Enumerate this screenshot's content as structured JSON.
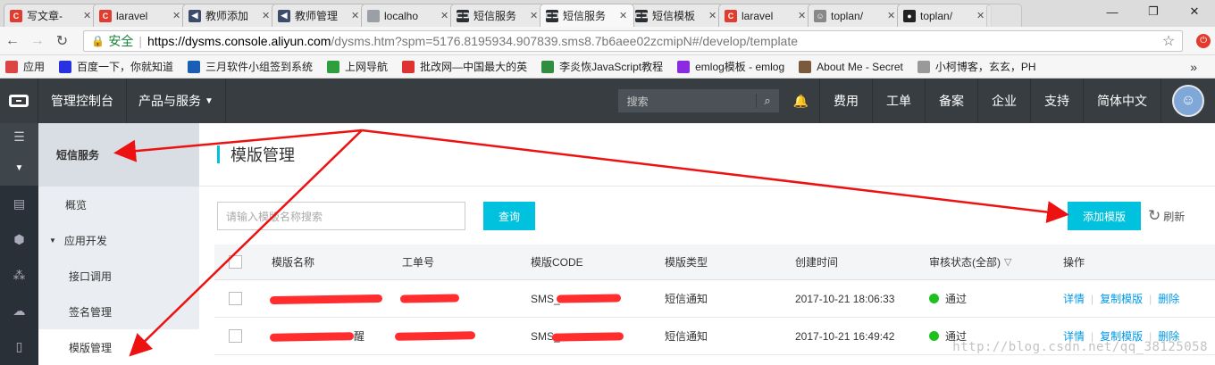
{
  "browser": {
    "tabs": [
      {
        "label": "写文章-",
        "icon": "csdn-icon",
        "color": "#e33b2e",
        "glyph": "C"
      },
      {
        "label": "laravel",
        "icon": "csdn-icon",
        "color": "#e33b2e",
        "glyph": "C"
      },
      {
        "label": "教师添加",
        "icon": "media-icon",
        "color": "#3b4d6b",
        "glyph": "◀"
      },
      {
        "label": "教师管理",
        "icon": "media-icon",
        "color": "#3b4d6b",
        "glyph": "◀"
      },
      {
        "label": "localho",
        "icon": "page-icon",
        "color": "#9aa0a6",
        "glyph": ""
      },
      {
        "label": "短信服务",
        "icon": "aliyun-icon",
        "color": "#2b2f33",
        "glyph": "⊏⊐"
      },
      {
        "label": "短信服务",
        "icon": "aliyun-icon",
        "color": "#2b2f33",
        "glyph": "⊏⊐",
        "active": true
      },
      {
        "label": "短信模板",
        "icon": "aliyun-icon",
        "color": "#2b2f33",
        "glyph": "⊏⊐"
      },
      {
        "label": "laravel",
        "icon": "csdn-icon",
        "color": "#e33b2e",
        "glyph": "C"
      },
      {
        "label": "toplan/",
        "icon": "octocat-icon",
        "color": "#888888",
        "glyph": "☺"
      },
      {
        "label": "toplan/",
        "icon": "github-icon",
        "color": "#222222",
        "glyph": "●"
      }
    ],
    "secure_label": "安全",
    "url_host": "https://dysms.console.aliyun.com",
    "url_path": "/dysms.htm?spm=5176.8195934.907839.sms8.7b6aee02zcmipN#/develop/template",
    "bookmarks": [
      {
        "label": "应用",
        "icon": "apps-icon",
        "color": "#d44"
      },
      {
        "label": "百度一下，你就知道",
        "icon": "baidu-icon",
        "color": "#2932e1"
      },
      {
        "label": "三月软件小组签到系统",
        "icon": "globe-icon",
        "color": "#1a5fb4"
      },
      {
        "label": "上网导航",
        "icon": "hao123-icon",
        "color": "#2e9e3e"
      },
      {
        "label": "批改网—中国最大的英",
        "icon": "pigai-icon",
        "color": "#d33"
      },
      {
        "label": "李炎恢JavaScript教程",
        "icon": "book-icon",
        "color": "#2f8f3f"
      },
      {
        "label": "emlog模板 - emlog",
        "icon": "em-icon",
        "color": "#8a2be2"
      },
      {
        "label": "About Me - Secret",
        "icon": "cat-icon",
        "color": "#7a5a3a"
      },
      {
        "label": "小柯博客，玄玄，PH",
        "icon": "page-icon",
        "color": "#999"
      }
    ]
  },
  "topnav": {
    "console": "管理控制台",
    "products": "产品与服务",
    "search_placeholder": "搜索",
    "items": [
      "费用",
      "工单",
      "备案",
      "企业",
      "支持",
      "简体中文"
    ]
  },
  "sidebar": {
    "header": "短信服务",
    "overview": "概览",
    "group": "应用开发",
    "items": [
      "接口调用",
      "签名管理",
      "模版管理"
    ]
  },
  "main": {
    "title": "模版管理",
    "search_placeholder": "请输入模版名称搜索",
    "query_button": "查询",
    "add_button": "添加模版",
    "refresh": "刷新",
    "columns": [
      "模版名称",
      "工单号",
      "模版CODE",
      "模版类型",
      "创建时间",
      "审核状态(全部)",
      "操作"
    ],
    "rows": [
      {
        "name": "",
        "order": "",
        "code": "SMS_",
        "type": "短信通知",
        "time": "2017-10-21 18:06:33",
        "status": "通过",
        "actions": [
          "详情",
          "复制模版",
          "删除"
        ]
      },
      {
        "name": "醒",
        "order": "",
        "code": "SMS_",
        "type": "短信通知",
        "time": "2017-10-21 16:49:42",
        "status": "通过",
        "actions": [
          "详情",
          "复制模版",
          "删除"
        ]
      }
    ],
    "status_color": "#1dc11d",
    "accent": "#00c1de"
  },
  "watermark": "http://blog.csdn.net/qq_38125058"
}
